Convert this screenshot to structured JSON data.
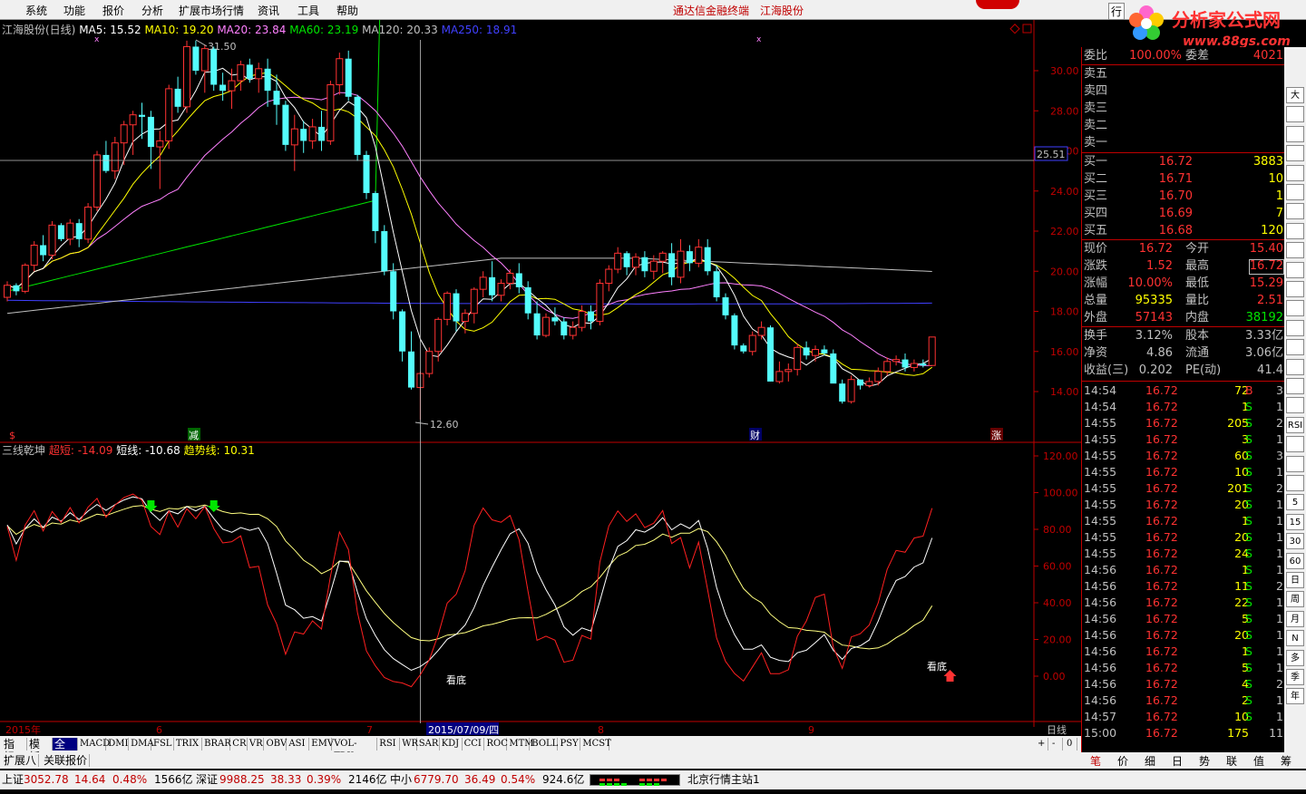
{
  "menu": {
    "items": [
      "系统",
      "功能",
      "报价",
      "分析",
      "扩展市场行情",
      "资讯",
      "工具",
      "帮助"
    ],
    "center_left": "通达信金融终端",
    "center_right": "江海股份",
    "right_fragment": "行"
  },
  "logo": {
    "brand": "分析家公式网",
    "url": "www.88gs.com"
  },
  "main_chart": {
    "header": {
      "stock": "江海股份(日线)",
      "ma5": "MA5: 15.52",
      "ma10": "MA10: 19.20",
      "ma20": "MA20: 23.84",
      "ma60": "MA60: 23.19",
      "ma120": "MA120: 20.33",
      "ma250": "MA250: 18.91"
    },
    "y_ticks": [
      "30.00",
      "28.00",
      "26.00",
      "24.00",
      "22.00",
      "20.00",
      "18.00",
      "16.00",
      "14.00"
    ],
    "crosshair_price": "25.51",
    "high_label": "31.50",
    "low_label": "12.60",
    "markers": {
      "m1": "$",
      "m2": "减",
      "m3": "财",
      "m4": "涨"
    }
  },
  "indicator": {
    "name": "三线乾坤",
    "super_short": "超短: -14.09",
    "short": "短线: -10.68",
    "trend": "趋势线: 10.31",
    "y_ticks": [
      "120.00",
      "100.00",
      "80.00",
      "60.00",
      "40.00",
      "20.00",
      "0.00"
    ],
    "bottom_label_1": "看底",
    "bottom_label_2": "看底"
  },
  "xaxis": {
    "year": "2015年",
    "m6": "6",
    "m7": "7",
    "date": "2015/07/09/四",
    "m8": "8",
    "m9": "9",
    "period": "日线"
  },
  "indicator_tabs": [
    "指标",
    "模板",
    "全部",
    "MACD",
    "DMI",
    "DMA",
    "FSL",
    "TRIX",
    "BRAR",
    "CR",
    "VR",
    "OBV",
    "ASI",
    "EMV",
    "VOL-TDX",
    "RSI",
    "WR",
    "SAR",
    "KDJ",
    "CCI",
    "ROC",
    "MTM",
    "BOLL",
    "PSY",
    "MCST"
  ],
  "tabs2": [
    "扩展八",
    "关联报价"
  ],
  "quote": {
    "weibi": {
      "label": "委比",
      "value": "100.00%",
      "label2": "委差",
      "value2": "4021"
    },
    "sells": [
      {
        "label": "卖五",
        "price": "",
        "vol": ""
      },
      {
        "label": "卖四",
        "price": "",
        "vol": ""
      },
      {
        "label": "卖三",
        "price": "",
        "vol": ""
      },
      {
        "label": "卖二",
        "price": "",
        "vol": ""
      },
      {
        "label": "卖一",
        "price": "",
        "vol": ""
      }
    ],
    "buys": [
      {
        "label": "买一",
        "price": "16.72",
        "vol": "3883"
      },
      {
        "label": "买二",
        "price": "16.71",
        "vol": "10"
      },
      {
        "label": "买三",
        "price": "16.70",
        "vol": "1"
      },
      {
        "label": "买四",
        "price": "16.69",
        "vol": "7"
      },
      {
        "label": "买五",
        "price": "16.68",
        "vol": "120"
      }
    ],
    "stats": [
      {
        "l1": "现价",
        "v1": "16.72",
        "l2": "今开",
        "v2": "15.40"
      },
      {
        "l1": "涨跌",
        "v1": "1.52",
        "l2": "最高",
        "v2": "16.72"
      },
      {
        "l1": "涨幅",
        "v1": "10.00%",
        "l2": "最低",
        "v2": "15.29"
      },
      {
        "l1": "总量",
        "v1": "95335",
        "l2": "量比",
        "v2": "2.51"
      },
      {
        "l1": "外盘",
        "v1": "57143",
        "l2": "内盘",
        "v2": "38192"
      }
    ],
    "fin": [
      {
        "l1": "换手",
        "v1": "3.12%",
        "l2": "股本",
        "v2": "3.33亿"
      },
      {
        "l1": "净资",
        "v1": "4.86",
        "l2": "流通",
        "v2": "3.06亿"
      },
      {
        "l1": "收益(三)",
        "v1": "0.202",
        "l2": "PE(动)",
        "v2": "41.4"
      }
    ],
    "ticks": [
      {
        "t": "14:54",
        "p": "16.72",
        "v": "72",
        "s": "B",
        "n": "3"
      },
      {
        "t": "14:54",
        "p": "16.72",
        "v": "1",
        "s": "S",
        "n": "1"
      },
      {
        "t": "14:55",
        "p": "16.72",
        "v": "205",
        "s": "S",
        "n": "2"
      },
      {
        "t": "14:55",
        "p": "16.72",
        "v": "3",
        "s": "S",
        "n": "1"
      },
      {
        "t": "14:55",
        "p": "16.72",
        "v": "60",
        "s": "S",
        "n": "3"
      },
      {
        "t": "14:55",
        "p": "16.72",
        "v": "10",
        "s": "S",
        "n": "1"
      },
      {
        "t": "14:55",
        "p": "16.72",
        "v": "201",
        "s": "S",
        "n": "2"
      },
      {
        "t": "14:55",
        "p": "16.72",
        "v": "20",
        "s": "S",
        "n": "1"
      },
      {
        "t": "14:55",
        "p": "16.72",
        "v": "1",
        "s": "S",
        "n": "1"
      },
      {
        "t": "14:55",
        "p": "16.72",
        "v": "20",
        "s": "S",
        "n": "1"
      },
      {
        "t": "14:55",
        "p": "16.72",
        "v": "24",
        "s": "S",
        "n": "1"
      },
      {
        "t": "14:56",
        "p": "16.72",
        "v": "1",
        "s": "S",
        "n": "1"
      },
      {
        "t": "14:56",
        "p": "16.72",
        "v": "11",
        "s": "S",
        "n": "2"
      },
      {
        "t": "14:56",
        "p": "16.72",
        "v": "22",
        "s": "S",
        "n": "1"
      },
      {
        "t": "14:56",
        "p": "16.72",
        "v": "5",
        "s": "S",
        "n": "1"
      },
      {
        "t": "14:56",
        "p": "16.72",
        "v": "20",
        "s": "S",
        "n": "1"
      },
      {
        "t": "14:56",
        "p": "16.72",
        "v": "1",
        "s": "S",
        "n": "1"
      },
      {
        "t": "14:56",
        "p": "16.72",
        "v": "5",
        "s": "S",
        "n": "1"
      },
      {
        "t": "14:56",
        "p": "16.72",
        "v": "4",
        "s": "S",
        "n": "2"
      },
      {
        "t": "14:56",
        "p": "16.72",
        "v": "2",
        "s": "S",
        "n": "1"
      },
      {
        "t": "14:57",
        "p": "16.72",
        "v": "10",
        "s": "S",
        "n": "1"
      },
      {
        "t": "15:00",
        "p": "16.72",
        "v": "175",
        "s": "",
        "n": "11"
      }
    ]
  },
  "right_tools": [
    "大",
    "",
    "",
    "",
    "",
    "",
    "",
    "",
    "",
    "",
    "",
    "",
    "",
    "",
    "",
    "",
    "",
    "RSI",
    "",
    "",
    "",
    "5",
    "15",
    "30",
    "60",
    "日",
    "周",
    "月",
    "N",
    "多",
    "季",
    "年"
  ],
  "bottom_tabs": [
    "笔",
    "价",
    "细",
    "日",
    "势",
    "联",
    "值",
    "筹"
  ],
  "status": {
    "sh_label": "上证",
    "sh_val": "3052.78",
    "sh_chg": "14.64",
    "sh_pct": "0.48%",
    "sh_amt": "1566亿",
    "sz_label": "深证",
    "sz_val": "9988.25",
    "sz_chg": "38.33",
    "sz_pct": "0.39%",
    "sz_amt": "2146亿",
    "zx_label": "中小",
    "zx_val": "6779.70",
    "zx_chg": "36.49",
    "zx_pct": "0.54%",
    "zx_amt": "924.6亿",
    "server": "北京行情主站1"
  },
  "colors": {
    "up": "#ff3232",
    "down": "#54fcfc",
    "ma5": "#ffffff",
    "ma10": "#ffff00",
    "ma20": "#ff80ff",
    "ma60": "#00e600",
    "ma120": "#c0c0c0",
    "ma250": "#4040ff"
  },
  "candles": [
    [
      18.7,
      19.5,
      18.5,
      19.3
    ],
    [
      19.3,
      19.4,
      18.8,
      19.0
    ],
    [
      19.0,
      20.4,
      18.9,
      20.3
    ],
    [
      20.3,
      21.5,
      20.0,
      21.3
    ],
    [
      21.3,
      21.8,
      20.5,
      20.8
    ],
    [
      20.8,
      22.5,
      20.6,
      22.3
    ],
    [
      22.3,
      22.4,
      21.5,
      21.6
    ],
    [
      21.6,
      22.6,
      21.3,
      22.4
    ],
    [
      22.4,
      22.6,
      21.2,
      21.6
    ],
    [
      21.6,
      23.4,
      21.4,
      23.2
    ],
    [
      23.2,
      26.0,
      23.0,
      25.8
    ],
    [
      25.8,
      26.5,
      24.9,
      25.0
    ],
    [
      25.0,
      26.7,
      24.6,
      26.4
    ],
    [
      26.4,
      27.5,
      25.3,
      27.3
    ],
    [
      27.3,
      28.0,
      25.8,
      27.8
    ],
    [
      27.8,
      28.4,
      26.6,
      27.7
    ],
    [
      27.7,
      28.0,
      25.1,
      26.2
    ],
    [
      26.2,
      27.0,
      24.1,
      26.5
    ],
    [
      26.5,
      29.3,
      26.1,
      29.1
    ],
    [
      29.1,
      29.7,
      27.9,
      28.2
    ],
    [
      28.2,
      31.5,
      27.9,
      31.2
    ],
    [
      31.2,
      31.5,
      29.8,
      30.0
    ],
    [
      30.0,
      31.3,
      28.9,
      31.1
    ],
    [
      31.1,
      31.2,
      29.0,
      29.3
    ],
    [
      29.3,
      29.9,
      28.5,
      29.0
    ],
    [
      29.0,
      30.1,
      28.1,
      29.5
    ],
    [
      29.5,
      30.5,
      29.0,
      30.3
    ],
    [
      30.3,
      30.6,
      29.4,
      29.6
    ],
    [
      29.6,
      30.4,
      28.9,
      30.1
    ],
    [
      30.1,
      30.6,
      28.2,
      29.0
    ],
    [
      29.0,
      29.8,
      27.3,
      28.3
    ],
    [
      28.3,
      28.5,
      26.0,
      26.3
    ],
    [
      26.3,
      27.8,
      25.0,
      27.1
    ],
    [
      27.1,
      27.5,
      25.9,
      26.5
    ],
    [
      26.5,
      27.6,
      26.1,
      27.2
    ],
    [
      27.2,
      28.0,
      26.0,
      26.5
    ],
    [
      26.5,
      29.5,
      26.3,
      29.3
    ],
    [
      29.3,
      30.9,
      28.8,
      30.6
    ],
    [
      30.6,
      31.0,
      28.5,
      28.7
    ],
    [
      28.7,
      28.8,
      25.5,
      25.8
    ],
    [
      25.8,
      26.0,
      23.6,
      23.9
    ],
    [
      23.9,
      24.0,
      21.4,
      22.0
    ],
    [
      22.0,
      22.3,
      19.8,
      20.0
    ],
    [
      20.0,
      20.4,
      17.6,
      18.0
    ],
    [
      18.0,
      18.1,
      15.5,
      16.0
    ],
    [
      16.0,
      17.0,
      14.1,
      14.2
    ],
    [
      14.2,
      15.0,
      12.6,
      14.9
    ],
    [
      14.9,
      16.2,
      14.7,
      16.0
    ],
    [
      16.0,
      17.7,
      15.5,
      17.6
    ],
    [
      17.6,
      19.0,
      17.3,
      18.9
    ],
    [
      18.9,
      19.1,
      17.0,
      17.5
    ],
    [
      17.5,
      18.1,
      16.9,
      17.9
    ],
    [
      17.9,
      19.2,
      17.4,
      19.1
    ],
    [
      19.1,
      20.0,
      18.7,
      19.7
    ],
    [
      19.7,
      20.5,
      18.5,
      18.8
    ],
    [
      18.8,
      19.6,
      18.5,
      19.4
    ],
    [
      19.4,
      20.1,
      19.1,
      19.9
    ],
    [
      19.9,
      20.4,
      18.9,
      19.2
    ],
    [
      19.2,
      19.5,
      17.6,
      17.9
    ],
    [
      17.9,
      18.5,
      16.6,
      16.8
    ],
    [
      16.8,
      17.9,
      16.7,
      17.7
    ],
    [
      17.7,
      18.2,
      17.3,
      17.5
    ],
    [
      17.5,
      17.7,
      16.6,
      16.8
    ],
    [
      16.8,
      17.5,
      16.6,
      17.2
    ],
    [
      17.2,
      18.3,
      17.0,
      18.0
    ],
    [
      18.0,
      18.3,
      17.1,
      17.5
    ],
    [
      17.5,
      19.6,
      17.3,
      19.4
    ],
    [
      19.4,
      20.3,
      19.0,
      20.1
    ],
    [
      20.1,
      21.2,
      19.9,
      20.9
    ],
    [
      20.9,
      21.0,
      19.8,
      20.2
    ],
    [
      20.2,
      20.9,
      19.8,
      20.7
    ],
    [
      20.7,
      21.0,
      19.7,
      20.0
    ],
    [
      20.0,
      20.8,
      19.6,
      20.5
    ],
    [
      20.5,
      21.0,
      19.9,
      20.9
    ],
    [
      20.9,
      21.4,
      19.3,
      19.7
    ],
    [
      19.7,
      21.6,
      19.4,
      21.0
    ],
    [
      21.0,
      21.3,
      20.0,
      20.4
    ],
    [
      20.4,
      21.6,
      20.2,
      21.2
    ],
    [
      21.2,
      21.6,
      19.8,
      20.0
    ],
    [
      20.0,
      20.3,
      18.5,
      18.7
    ],
    [
      18.7,
      18.9,
      17.6,
      17.8
    ],
    [
      17.8,
      17.9,
      16.1,
      16.3
    ],
    [
      16.3,
      16.4,
      15.9,
      16.0
    ],
    [
      16.0,
      17.0,
      15.8,
      16.8
    ],
    [
      16.8,
      17.5,
      16.6,
      17.2
    ],
    [
      17.2,
      17.3,
      14.5,
      14.5
    ],
    [
      14.5,
      15.5,
      14.4,
      15.0
    ],
    [
      15.0,
      15.4,
      14.5,
      15.1
    ],
    [
      15.1,
      16.4,
      14.8,
      16.2
    ],
    [
      16.2,
      16.5,
      15.6,
      15.8
    ],
    [
      15.8,
      16.3,
      15.5,
      16.1
    ],
    [
      16.1,
      16.3,
      15.8,
      15.9
    ],
    [
      15.9,
      16.1,
      14.6,
      14.4
    ],
    [
      14.4,
      14.6,
      13.4,
      13.5
    ],
    [
      13.5,
      14.8,
      13.4,
      14.6
    ],
    [
      14.6,
      14.6,
      14.1,
      14.3
    ],
    [
      14.3,
      14.7,
      14.2,
      14.5
    ],
    [
      14.5,
      15.2,
      14.3,
      15.0
    ],
    [
      15.0,
      15.7,
      14.8,
      15.5
    ],
    [
      15.5,
      15.8,
      15.3,
      15.6
    ],
    [
      15.6,
      15.9,
      15.0,
      15.2
    ],
    [
      15.2,
      15.6,
      15.0,
      15.4
    ],
    [
      15.4,
      15.6,
      15.2,
      15.3
    ],
    [
      15.3,
      16.72,
      15.29,
      16.72
    ]
  ]
}
